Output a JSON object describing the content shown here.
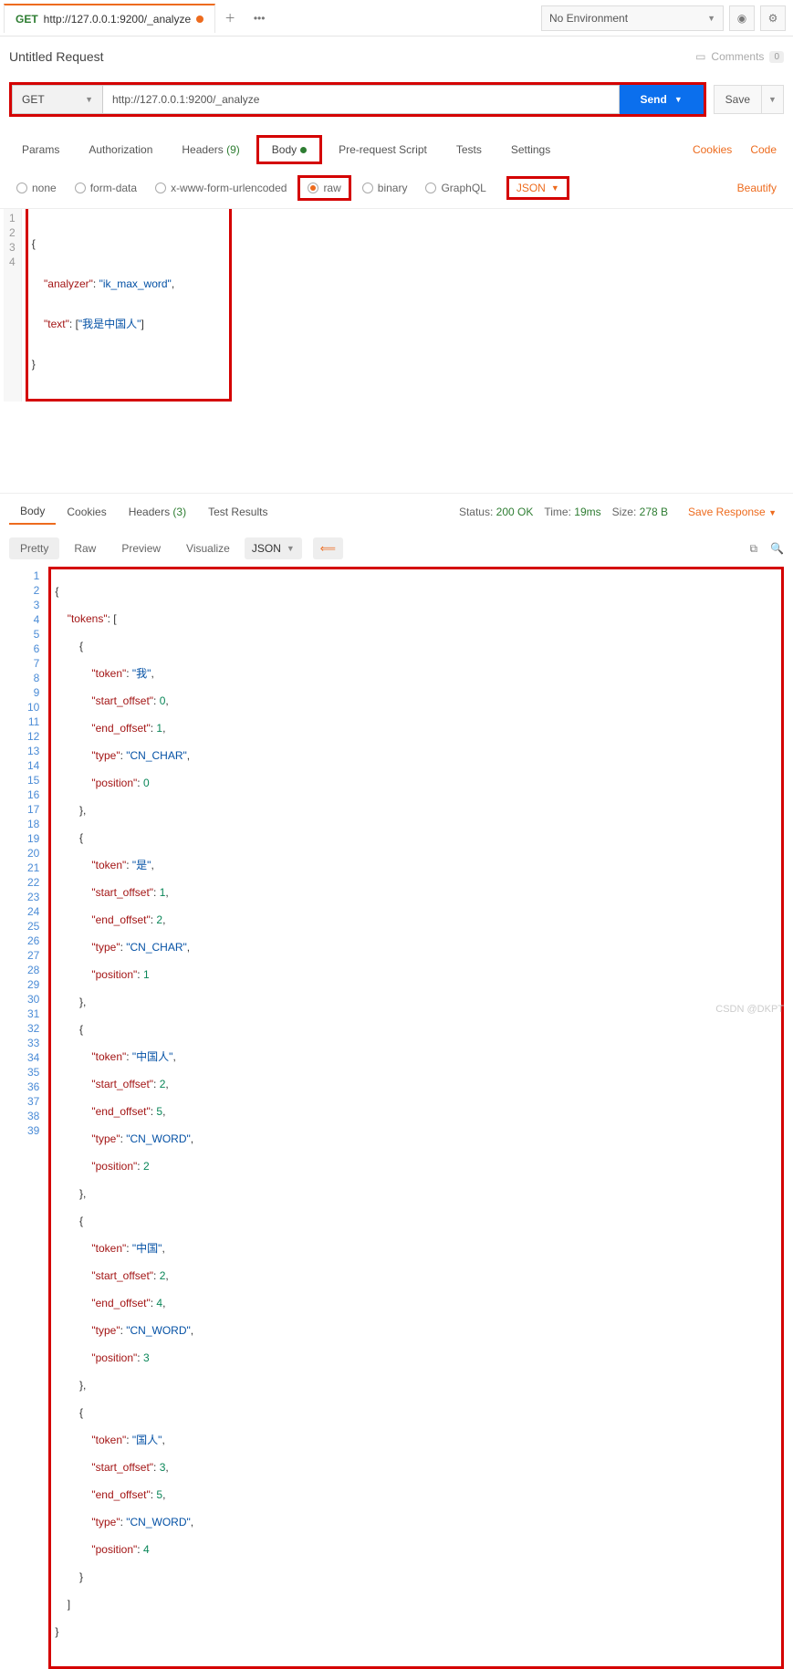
{
  "tab": {
    "method": "GET",
    "url": "http://127.0.0.1:9200/_analyze"
  },
  "env": {
    "label": "No Environment"
  },
  "request": {
    "title": "Untitled Request",
    "comments": "Comments",
    "commentsCount": "0"
  },
  "url": {
    "method": "GET",
    "value": "http://127.0.0.1:9200/_analyze",
    "send": "Send",
    "save": "Save"
  },
  "reqTabs": [
    "Params",
    "Authorization",
    "Headers",
    "Body",
    "Pre-request Script",
    "Tests",
    "Settings"
  ],
  "headersCount": "(9)",
  "rightLinks": {
    "cookies": "Cookies",
    "code": "Code",
    "beautify": "Beautify"
  },
  "bodyTypes": [
    "none",
    "form-data",
    "x-www-form-urlencoded",
    "raw",
    "binary",
    "GraphQL"
  ],
  "bodyFormat": "JSON",
  "reqBody": {
    "l1": "{",
    "l2a": "\"analyzer\"",
    "l2b": ": ",
    "l2c": "\"ik_max_word\"",
    "l2d": ",",
    "l3a": "\"text\"",
    "l3b": ": [",
    "l3c": "\"我是中国人\"",
    "l3d": "]",
    "l4": "}"
  },
  "respTabs": [
    "Body",
    "Cookies",
    "Headers",
    "Test Results"
  ],
  "respHeadersCount": "(3)",
  "status": {
    "sLabel": "Status:",
    "sVal": "200 OK",
    "tLabel": "Time:",
    "tVal": "19ms",
    "szLabel": "Size:",
    "szVal": "278 B",
    "save": "Save Response"
  },
  "respToolbar": [
    "Pretty",
    "Raw",
    "Preview",
    "Visualize"
  ],
  "respFormat": "JSON",
  "resp": {
    "tokens_key": "\"tokens\"",
    "token_key": "\"token\"",
    "so_key": "\"start_offset\"",
    "eo_key": "\"end_offset\"",
    "type_key": "\"type\"",
    "pos_key": "\"position\"",
    "t1": "\"我\"",
    "t2": "\"是\"",
    "t3": "\"中国人\"",
    "t4": "\"中国\"",
    "t5": "\"国人\"",
    "cnchar": "\"CN_CHAR\"",
    "cnword": "\"CN_WORD\"",
    "n0": "0",
    "n1": "1",
    "n2": "2",
    "n3": "3",
    "n4": "4",
    "n5": "5"
  },
  "watermark": "CSDN @DKPT"
}
